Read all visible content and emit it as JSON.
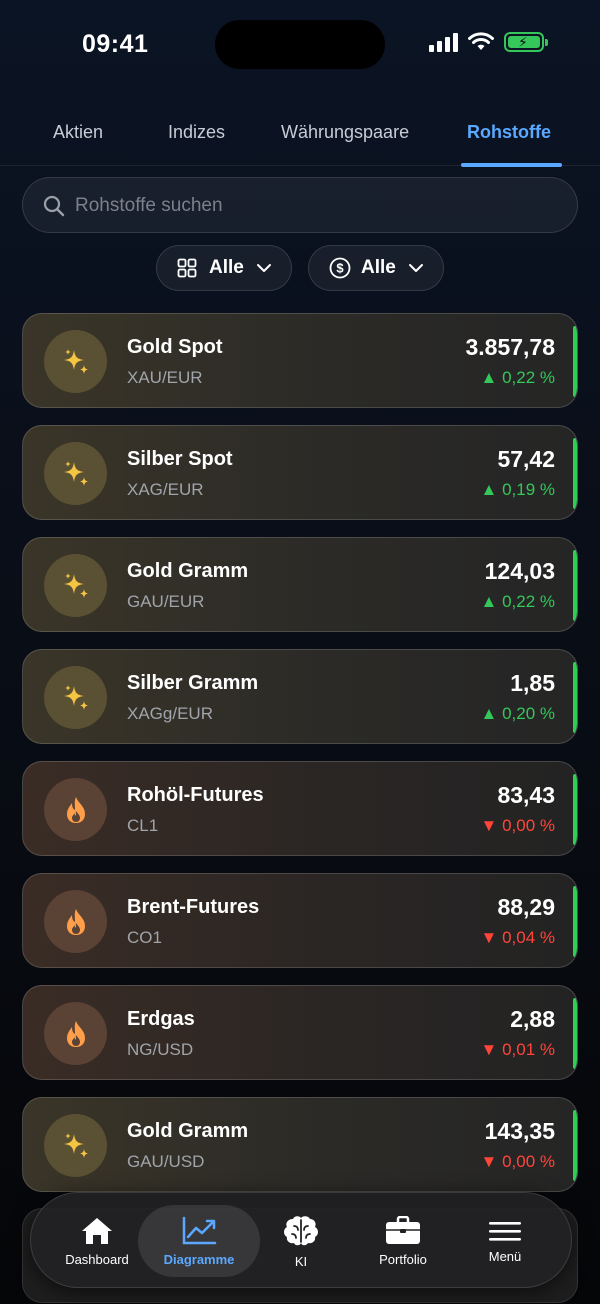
{
  "status_bar": {
    "time": "09:41"
  },
  "tabs": [
    {
      "label": "Aktien"
    },
    {
      "label": "Indizes"
    },
    {
      "label": "Währungspaare"
    },
    {
      "label": "Rohstoffe",
      "active": true
    }
  ],
  "search": {
    "placeholder": "Rohstoffe suchen",
    "value": ""
  },
  "filters": [
    {
      "icon": "grid-icon",
      "label": "Alle"
    },
    {
      "icon": "dollar-circle-icon",
      "label": "Alle"
    }
  ],
  "colors": {
    "accent": "#5aa8ff",
    "up": "#34c759",
    "down": "#ff453a"
  },
  "commodities": [
    {
      "name": "Gold Spot",
      "symbol": "XAU/EUR",
      "price": "3.857,78",
      "change": "▲ 0,22 %",
      "direction": "up",
      "icon": "sparkle-icon"
    },
    {
      "name": "Silber Spot",
      "symbol": "XAG/EUR",
      "price": "57,42",
      "change": "▲ 0,19 %",
      "direction": "up",
      "icon": "sparkle-icon"
    },
    {
      "name": "Gold Gramm",
      "symbol": "GAU/EUR",
      "price": "124,03",
      "change": "▲ 0,22 %",
      "direction": "up",
      "icon": "sparkle-icon"
    },
    {
      "name": "Silber Gramm",
      "symbol": "XAGg/EUR",
      "price": "1,85",
      "change": "▲ 0,20 %",
      "direction": "up",
      "icon": "sparkle-icon"
    },
    {
      "name": "Rohöl-Futures",
      "symbol": "CL1",
      "price": "83,43",
      "change": "▼ 0,00 %",
      "direction": "down",
      "icon": "flame-icon"
    },
    {
      "name": "Brent-Futures",
      "symbol": "CO1",
      "price": "88,29",
      "change": "▼ 0,04 %",
      "direction": "down",
      "icon": "flame-icon"
    },
    {
      "name": "Erdgas",
      "symbol": "NG/USD",
      "price": "2,88",
      "change": "▼ 0,01 %",
      "direction": "down",
      "icon": "flame-icon"
    },
    {
      "name": "Gold Gramm",
      "symbol": "GAU/USD",
      "price": "143,35",
      "change": "▼ 0,00 %",
      "direction": "down",
      "icon": "sparkle-icon"
    }
  ],
  "bottom_nav": [
    {
      "label": "Dashboard",
      "icon": "home-icon"
    },
    {
      "label": "Diagramme",
      "icon": "chart-icon",
      "active": true
    },
    {
      "label": "KI",
      "icon": "brain-icon"
    },
    {
      "label": "Portfolio",
      "icon": "briefcase-icon"
    },
    {
      "label": "Menü",
      "icon": "menu-icon"
    }
  ]
}
